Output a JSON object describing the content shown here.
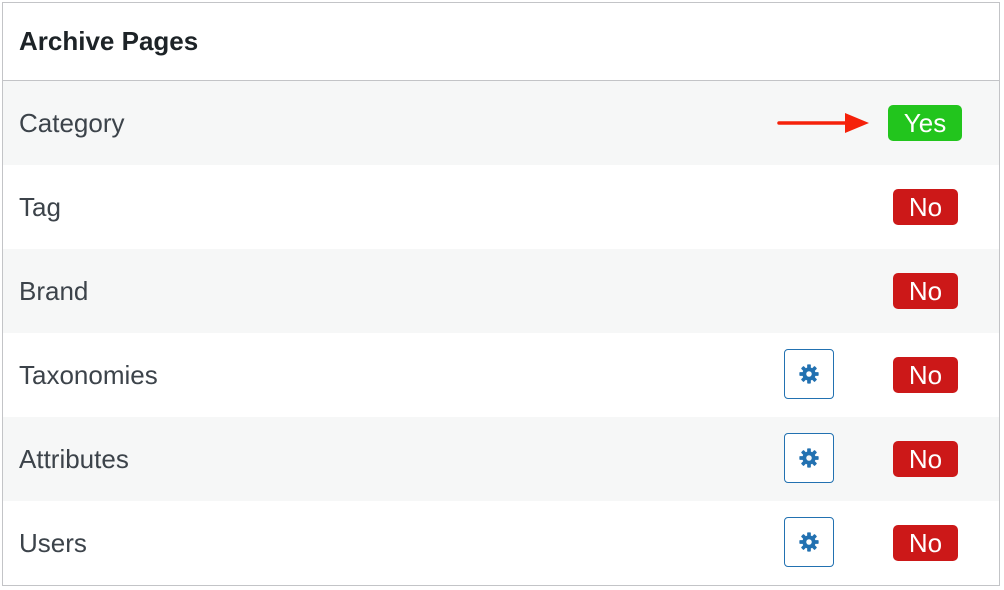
{
  "header": {
    "title": "Archive Pages"
  },
  "rows": [
    {
      "label": "Category",
      "status": "Yes",
      "status_color": "#22c51d",
      "has_settings": false
    },
    {
      "label": "Tag",
      "status": "No",
      "status_color": "#cc1818",
      "has_settings": false
    },
    {
      "label": "Brand",
      "status": "No",
      "status_color": "#cc1818",
      "has_settings": false
    },
    {
      "label": "Taxonomies",
      "status": "No",
      "status_color": "#cc1818",
      "has_settings": true,
      "settings_icon": "gear-icon"
    },
    {
      "label": "Attributes",
      "status": "No",
      "status_color": "#cc1818",
      "has_settings": true,
      "settings_icon": "gear-icon"
    },
    {
      "label": "Users",
      "status": "No",
      "status_color": "#cc1818",
      "has_settings": true,
      "settings_icon": "gear-icon"
    }
  ],
  "annotation": {
    "icon": "arrow-right-icon",
    "color": "#f5210a"
  },
  "colors": {
    "accent": "#2271b1",
    "border": "#c3c4c7",
    "row_alt_bg": "#f6f7f7"
  }
}
